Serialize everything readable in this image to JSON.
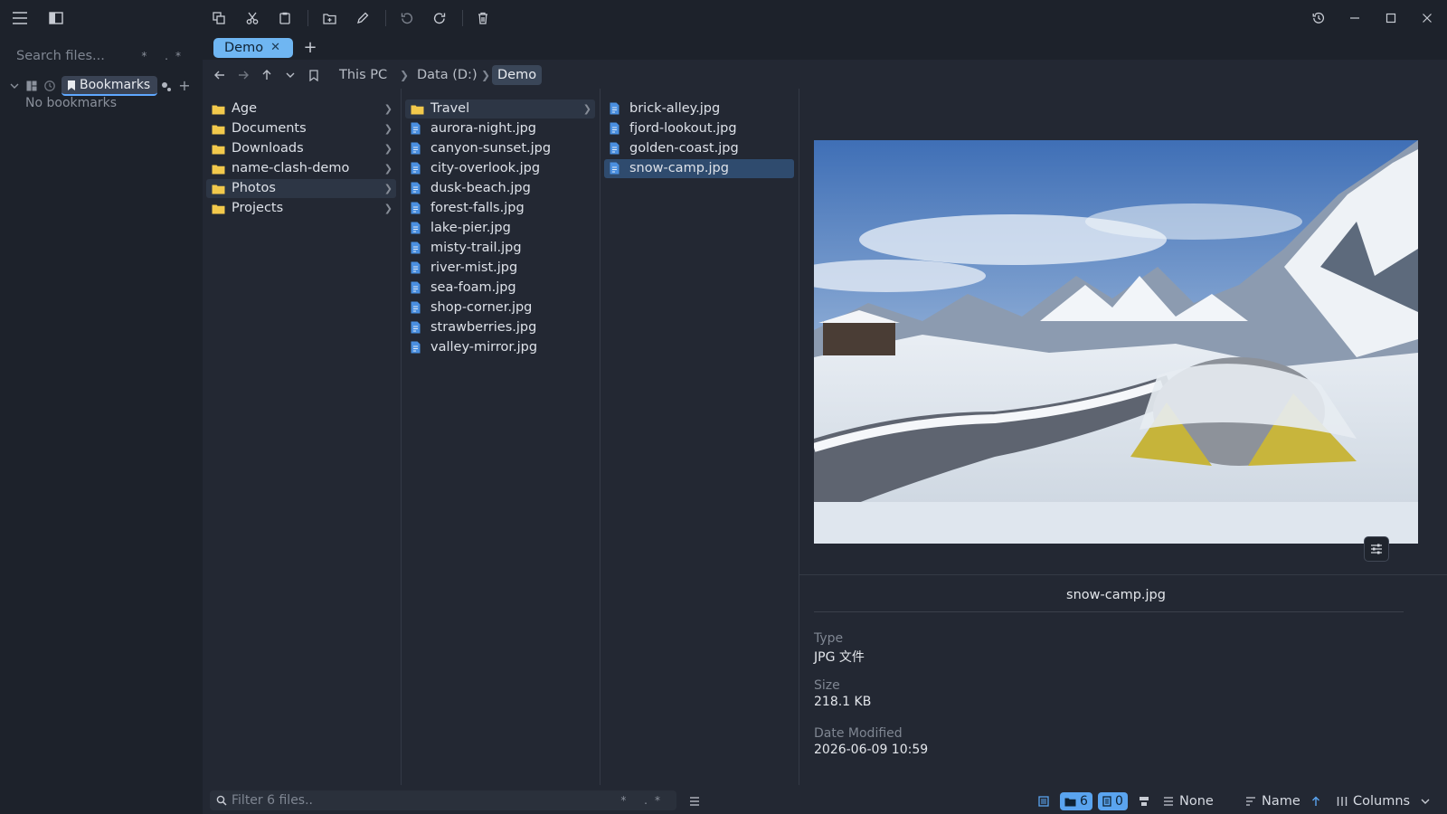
{
  "sidebar": {
    "search_placeholder": "Search files...",
    "search_options": "* .*",
    "bookmarks_label": "Bookmarks",
    "no_bookmarks": "No bookmarks"
  },
  "tabs": [
    {
      "label": "Demo",
      "close": "✕"
    }
  ],
  "new_tab": "+",
  "breadcrumb": [
    "This PC",
    "Data (D:)",
    "Demo"
  ],
  "columns": {
    "root": [
      "Age",
      "Documents",
      "Downloads",
      "name-clash-demo",
      "Photos",
      "Projects"
    ],
    "photos": {
      "folder": "Travel",
      "files": [
        "aurora-night.jpg",
        "canyon-sunset.jpg",
        "city-overlook.jpg",
        "dusk-beach.jpg",
        "forest-falls.jpg",
        "lake-pier.jpg",
        "misty-trail.jpg",
        "river-mist.jpg",
        "sea-foam.jpg",
        "shop-corner.jpg",
        "strawberries.jpg",
        "valley-mirror.jpg"
      ]
    },
    "travel": [
      "brick-alley.jpg",
      "fjord-lookout.jpg",
      "golden-coast.jpg",
      "snow-camp.jpg"
    ]
  },
  "preview": {
    "file_name": "snow-camp.jpg",
    "type_label": "Type",
    "type_value": "JPG 文件",
    "size_label": "Size",
    "size_value": "218.1 KB",
    "date_label": "Date Modified",
    "date_value": "2026-06-09 10:59"
  },
  "status": {
    "filter_placeholder": "Filter 6 files..",
    "filter_options": "* .*",
    "folder_count": "6",
    "file_count": "0",
    "group_value": "None",
    "sort_value": "Name",
    "view_value": "Columns"
  },
  "colors": {
    "accent": "#5aa4ef",
    "selection": "#2f4b6e",
    "folder": "#f2c94c",
    "file": "#4a8fe0"
  }
}
